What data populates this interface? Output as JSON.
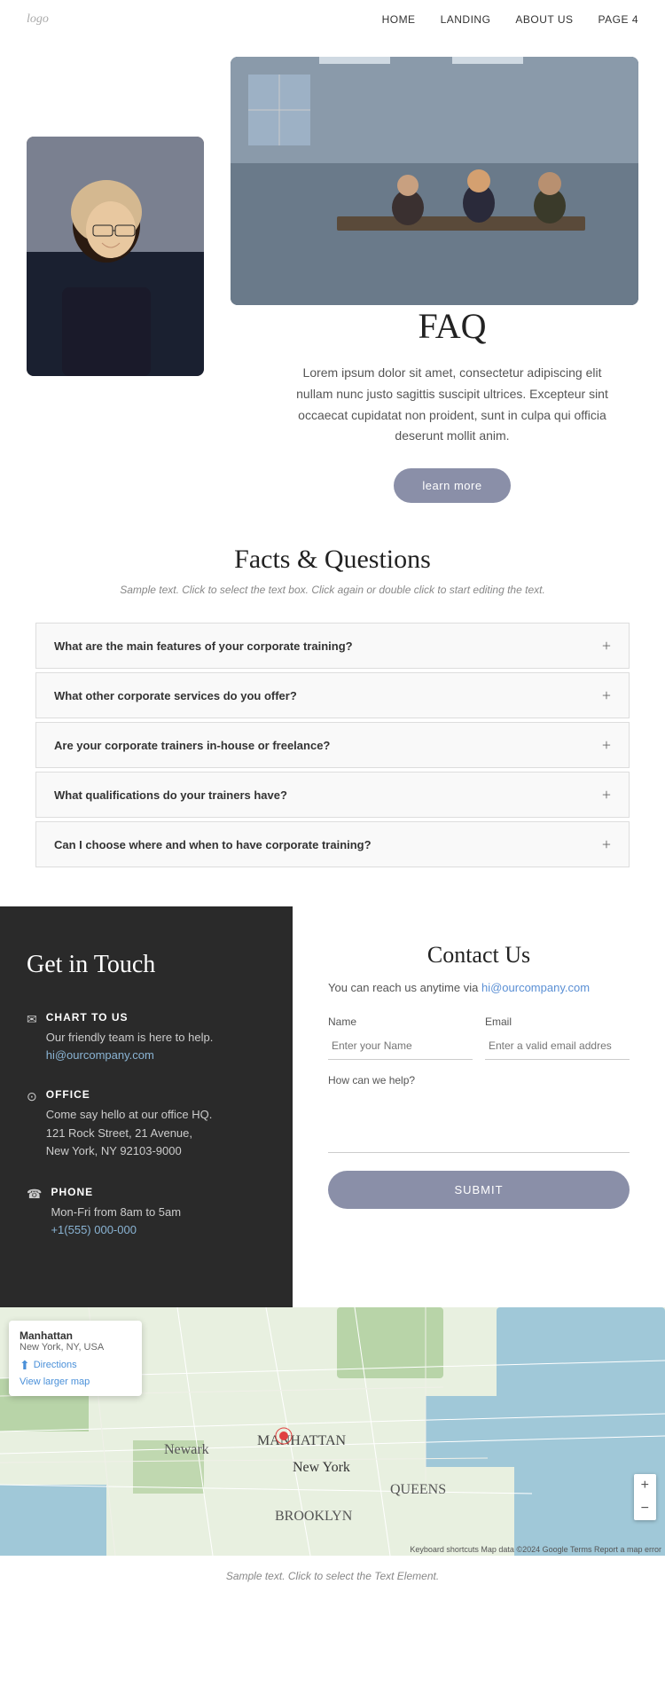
{
  "nav": {
    "logo": "logo",
    "links": [
      {
        "label": "HOME",
        "href": "#"
      },
      {
        "label": "LANDING",
        "href": "#"
      },
      {
        "label": "ABOUT US",
        "href": "#"
      },
      {
        "label": "PAGE 4",
        "href": "#"
      }
    ]
  },
  "hero": {
    "title": "FAQ",
    "description": "Lorem ipsum dolor sit amet, consectetur adipiscing elit nullam nunc justo sagittis suscipit ultrices. Excepteur sint occaecat cupidatat non proident, sunt in culpa qui officia deserunt mollit anim.",
    "button_label": "learn more"
  },
  "faq_section": {
    "title": "Facts & Questions",
    "subtitle": "Sample text. Click to select the text box. Click again or double click to start editing the text.",
    "items": [
      {
        "question": "What are the main features of your corporate training?"
      },
      {
        "question": "What other corporate services do you offer?"
      },
      {
        "question": "Are your corporate trainers in-house or freelance?"
      },
      {
        "question": "What qualifications do your trainers have?"
      },
      {
        "question": "Can I choose where and when to have corporate training?"
      }
    ]
  },
  "contact_left": {
    "title": "Get in Touch",
    "chart_title": "CHART TO US",
    "chart_desc": "Our friendly team is here to help.",
    "chart_email": "hi@ourcompany.com",
    "office_title": "OFFICE",
    "office_desc": "Come say hello at our office HQ.",
    "office_address1": "121 Rock Street, 21 Avenue,",
    "office_address2": "New York, NY 92103-9000",
    "phone_title": "PHONE",
    "phone_hours": "Mon-Fri from 8am to 5am",
    "phone_number": "+1(555) 000-000"
  },
  "contact_right": {
    "title": "Contact Us",
    "reach_text": "You can reach us anytime via",
    "reach_email": "hi@ourcompany.com",
    "name_label": "Name",
    "name_placeholder": "Enter your Name",
    "email_label": "Email",
    "email_placeholder": "Enter a valid email addres",
    "message_label": "How can we help?",
    "message_placeholder": "",
    "submit_label": "SUBMIT"
  },
  "map": {
    "location_title": "Manhattan",
    "location_sub": "New York, NY, USA",
    "directions_label": "Directions",
    "larger_label": "View larger map",
    "label_new_york": "New York",
    "label_queens": "QUEENS",
    "label_brooklyn": "BROOKLYN",
    "label_newark": "Newark",
    "label_manhattan": "MANHATTAN",
    "attribution": "Keyboard shortcuts  Map data ©2024 Google  Terms  Report a map error"
  },
  "footer": {
    "text": "Sample text. Click to select the Text Element."
  }
}
